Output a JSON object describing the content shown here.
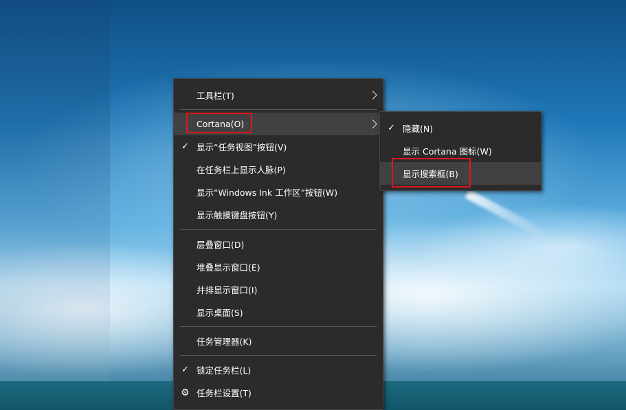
{
  "main_menu": {
    "items": [
      {
        "label": "工具栏(T)",
        "checked": false,
        "submenu": true
      },
      {
        "label": "Cortana(O)",
        "checked": false,
        "submenu": true,
        "highlighted": true
      },
      {
        "label": "显示“任务视图”按钮(V)",
        "checked": true,
        "submenu": false
      },
      {
        "label": "在任务栏上显示人脉(P)",
        "checked": false,
        "submenu": false
      },
      {
        "label": "显示“Windows Ink 工作区”按钮(W)",
        "checked": false,
        "submenu": false
      },
      {
        "label": "显示触摸键盘按钮(Y)",
        "checked": false,
        "submenu": false
      },
      {
        "label": "层叠窗口(D)",
        "checked": false,
        "submenu": false
      },
      {
        "label": "堆叠显示窗口(E)",
        "checked": false,
        "submenu": false
      },
      {
        "label": "并排显示窗口(I)",
        "checked": false,
        "submenu": false
      },
      {
        "label": "显示桌面(S)",
        "checked": false,
        "submenu": false
      },
      {
        "label": "任务管理器(K)",
        "checked": false,
        "submenu": false
      },
      {
        "label": "锁定任务栏(L)",
        "checked": true,
        "submenu": false
      },
      {
        "label": "任务栏设置(T)",
        "checked": false,
        "submenu": false,
        "icon": "gear-icon"
      }
    ]
  },
  "cortana_submenu": {
    "items": [
      {
        "label": "隐藏(N)",
        "checked": true
      },
      {
        "label": "显示 Cortana 图标(W)",
        "checked": false
      },
      {
        "label": "显示搜索框(B)",
        "checked": false,
        "highlighted": true
      }
    ]
  },
  "icons": {
    "check": "✓",
    "gear": "⚙"
  },
  "colors": {
    "menu_bg": "#2b2b2b",
    "hover_bg": "#414141",
    "annotation_red": "#e3161c"
  }
}
